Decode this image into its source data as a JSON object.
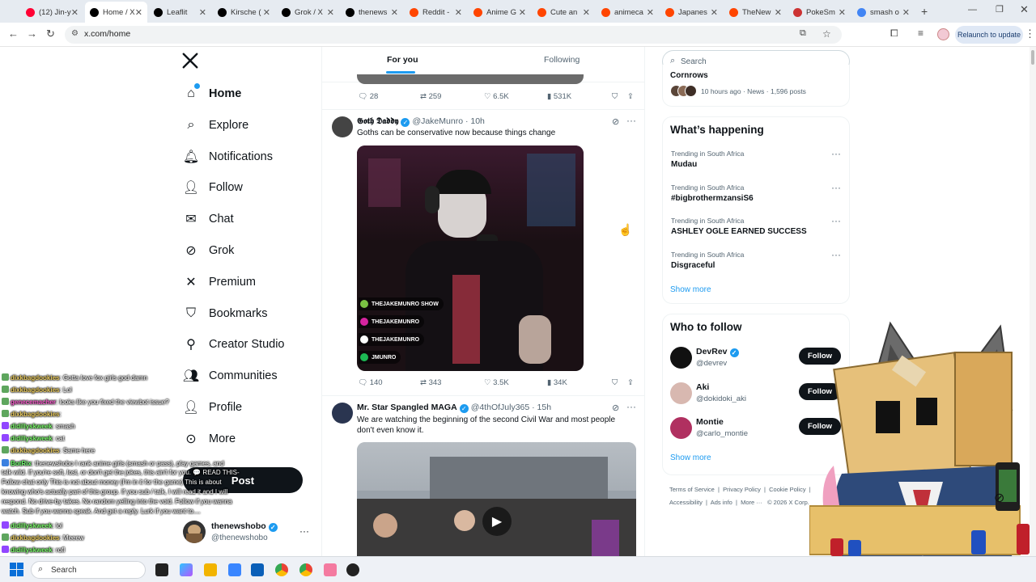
{
  "browser": {
    "tabs": [
      {
        "label": "(12) Jin-y",
        "color": "#ff0033"
      },
      {
        "label": "Home / X",
        "color": "#000000"
      },
      {
        "label": "Leaflit",
        "color": "#000000"
      },
      {
        "label": "Kirsche (",
        "color": "#000000"
      },
      {
        "label": "Grok / X",
        "color": "#000000"
      },
      {
        "label": "thenews",
        "color": "#000000"
      },
      {
        "label": "Reddit -",
        "color": "#ff4500"
      },
      {
        "label": "Anime G",
        "color": "#ff4500"
      },
      {
        "label": "Cute an",
        "color": "#ff4500"
      },
      {
        "label": "animeca",
        "color": "#ff4500"
      },
      {
        "label": "Japanes",
        "color": "#ff4500"
      },
      {
        "label": "TheNew",
        "color": "#ff4500"
      },
      {
        "label": "PokeSm",
        "color": "#cc3333"
      },
      {
        "label": "smash o",
        "color": "#4285f4"
      }
    ],
    "new_tab": "+",
    "url": "x.com/home",
    "relaunch_label": "Relaunch to update"
  },
  "sidebar": {
    "items": [
      {
        "label": "Home",
        "icon": "home-icon"
      },
      {
        "label": "Explore",
        "icon": "search-icon"
      },
      {
        "label": "Notifications",
        "icon": "bell-icon"
      },
      {
        "label": "Follow",
        "icon": "person-plus-icon"
      },
      {
        "label": "Chat",
        "icon": "mail-icon"
      },
      {
        "label": "Grok",
        "icon": "grok-icon"
      },
      {
        "label": "Premium",
        "icon": "x-logo-icon"
      },
      {
        "label": "Bookmarks",
        "icon": "bookmark-icon"
      },
      {
        "label": "Creator Studio",
        "icon": "creator-icon"
      },
      {
        "label": "Communities",
        "icon": "communities-icon"
      },
      {
        "label": "Profile",
        "icon": "profile-icon"
      },
      {
        "label": "More",
        "icon": "more-icon"
      }
    ],
    "post_label": "Post",
    "account": {
      "name": "thenewshobo",
      "handle": "@thenewshobo",
      "more": "···"
    }
  },
  "feed": {
    "tabs": {
      "for_you": "For you",
      "following": "Following"
    },
    "prev_post_stats": {
      "replies": "28",
      "reposts": "259",
      "likes": "6.5K",
      "views": "531K"
    },
    "posts": [
      {
        "name": "𝕲𝖔𝖙𝖍 𝕯𝖆𝖉𝖉𝖞",
        "handle": "@JakeMunro",
        "time": "· 10h",
        "text": "Goths can be conservative now because things change",
        "image_overlay_lines": [
          "THEJAKEMUNRO SHOW",
          "THEJAKEMUNRO",
          "THEJAKEMUNRO",
          "JMUNRO"
        ],
        "stats": {
          "replies": "140",
          "reposts": "343",
          "likes": "3.5K",
          "views": "34K"
        }
      },
      {
        "name": "Mr. Star Spangled MAGA",
        "handle": "@4thOfJuly365",
        "time": "· 15h",
        "text": "We are watching the beginning of the second Civil War and most people don't even know it."
      }
    ]
  },
  "right": {
    "search_placeholder": "Search",
    "top_story": {
      "title": "Cornrows",
      "meta": "10 hours ago · News · 1,596 posts"
    },
    "happening_title": "What’s happening",
    "trends": [
      {
        "meta": "Trending in South Africa",
        "name": "Mudau"
      },
      {
        "meta": "Trending in South Africa",
        "name": "#bigbrothermzansiS6"
      },
      {
        "meta": "Trending in South Africa",
        "name": "ASHLEY OGLE EARNED SUCCESS"
      },
      {
        "meta": "Trending in South Africa",
        "name": "Disgraceful"
      }
    ],
    "show_more": "Show more",
    "who_to_follow_title": "Who to follow",
    "follow_suggestions": [
      {
        "name": "DevRev",
        "handle": "@devrev",
        "verified": true
      },
      {
        "name": "Aki",
        "handle": "@dokidoki_aki",
        "verified": false
      },
      {
        "name": "Montie",
        "handle": "@carlo_montie",
        "verified": false
      }
    ],
    "follow_label": "Follow",
    "show_more_2": "Show more",
    "footer_links": [
      "Terms of Service",
      "Privacy Policy",
      "Cookie Policy",
      "Accessibility",
      "Ads info",
      "More ···",
      "© 2026 X Corp."
    ]
  },
  "chat": {
    "lines": [
      {
        "user": "dixkbagdookies",
        "color": "#f0d060",
        "msg": ": Gotta love fox girls god damn"
      },
      {
        "user": "dixkbagdookies",
        "color": "#f0d060",
        "msg": ": Lol"
      },
      {
        "user": "genecemacher",
        "color": "#ff5fd2",
        "msg": ": looks like you fixed the viewbot issue?"
      },
      {
        "user": "dixkbagdookies",
        "color": "#f0d060",
        "msg": ":"
      },
      {
        "user": "didillyskweek",
        "color": "#7cff6b",
        "msg": ": smash"
      },
      {
        "user": "didillyskweek",
        "color": "#7cff6b",
        "msg": ": cat"
      },
      {
        "user": "dixkbagdookies",
        "color": "#f0d060",
        "msg": ": Same here"
      },
      {
        "user": "BotRix",
        "color": "#6bff6b",
        "msg": ": thenewshobo I rank anime girls (smash or pass), play games, and"
      },
      {
        "user": "",
        "color": "#ffffff",
        "msg": "talk wild. If you're soft, lost, or don't get the jokes, this ain't for you. 💬 READ THIS-"
      },
      {
        "user": "",
        "color": "#ffffff",
        "msg": "Follow chat only This is not about money (I'm in it for the game) This is about"
      },
      {
        "user": "",
        "color": "#ffffff",
        "msg": "knowing who's actually part of this group. If you sub / talk, I will read it and I will"
      },
      {
        "user": "",
        "color": "#ffffff",
        "msg": "respond. No drive-by takes. No random yelling into the void. Follow if you wanna"
      },
      {
        "user": "",
        "color": "#ffffff",
        "msg": "watch. Sub if you wanna speak. And get a reply. Lurk if you want to...."
      },
      {
        "user": "didillyskweek",
        "color": "#7cff6b",
        "msg": ": lol"
      },
      {
        "user": "dixkbagdookies",
        "color": "#f0d060",
        "msg": ": Meeew"
      },
      {
        "user": "didillyskweek",
        "color": "#7cff6b",
        "msg": ": rofl"
      }
    ]
  },
  "taskbar": {
    "search_placeholder": "Search"
  }
}
